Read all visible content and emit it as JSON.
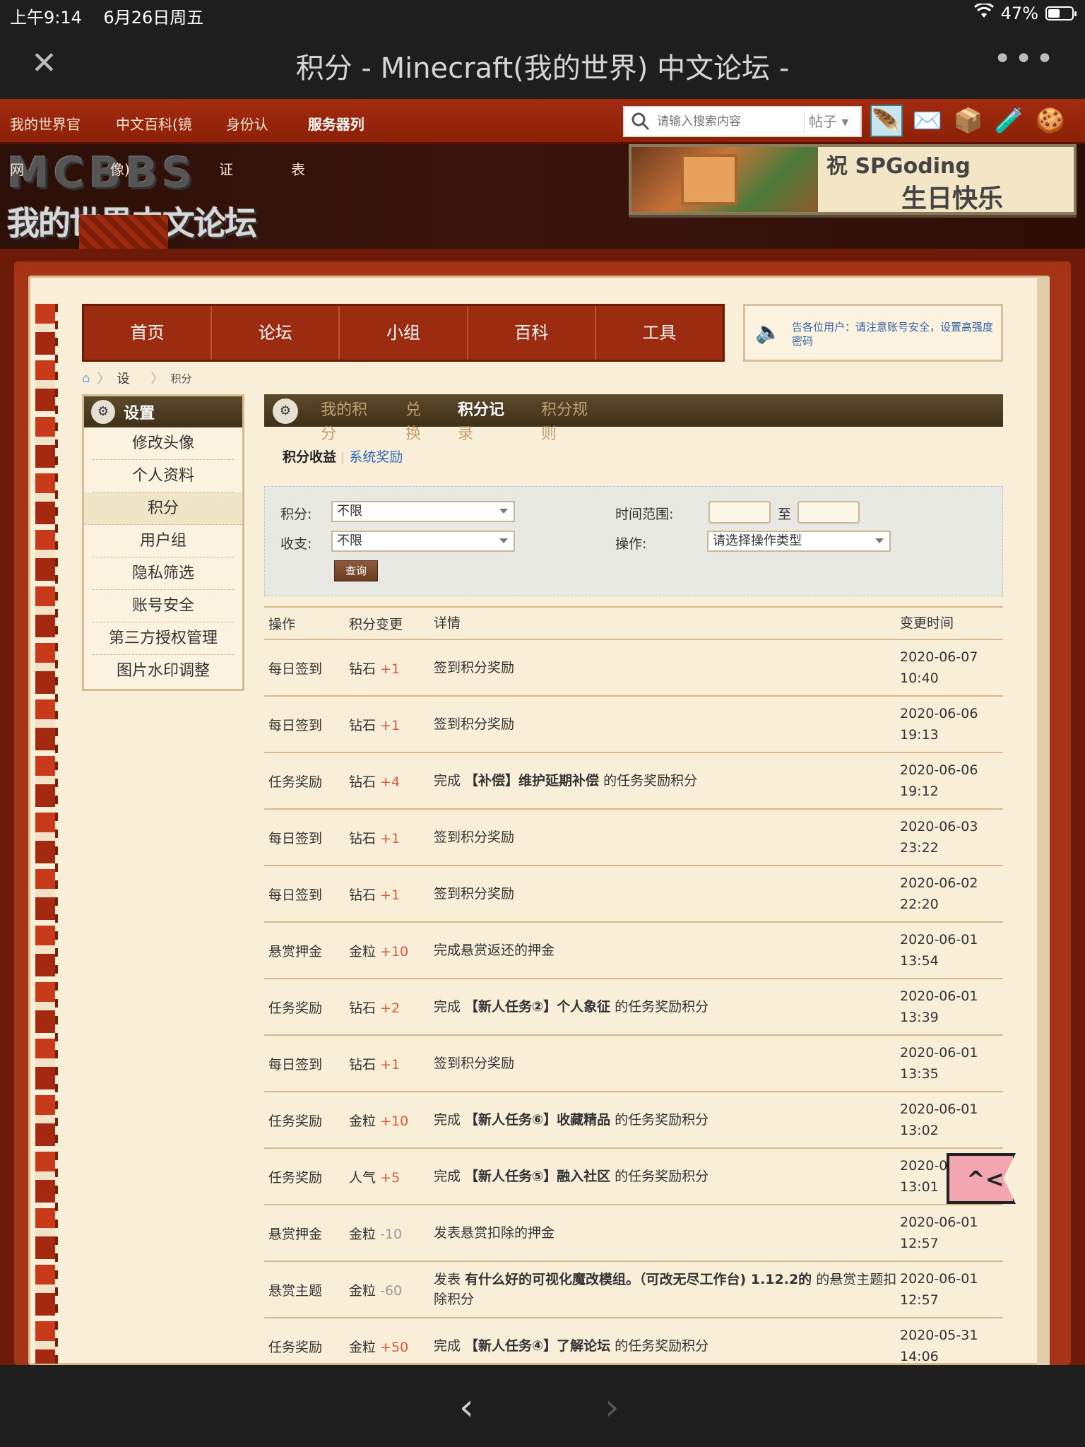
{
  "status": {
    "time": "上午9:14",
    "date": "6月26日周五",
    "battery": "47%"
  },
  "browser": {
    "title": "积分 - Minecraft(我的世界) 中文论坛 -",
    "close": "✕",
    "more": "•••",
    "back": "‹",
    "forward": "›"
  },
  "site_links": [
    {
      "label": "我的世界官",
      "wrap": "网"
    },
    {
      "label": "中文百科(镜",
      "wrap": "像)"
    },
    {
      "label": "身份认",
      "wrap": "证"
    },
    {
      "label": "服务器列",
      "wrap": "表"
    }
  ],
  "search": {
    "placeholder": "请输入搜索内容",
    "scope": "帖子"
  },
  "logo": {
    "top": "MCBBS",
    "bottom": "我的世界中文论坛"
  },
  "birthday": {
    "line1": "祝 SPGoding",
    "line2": "生日快乐"
  },
  "main_nav": [
    "首页",
    "论坛",
    "小组",
    "百科",
    "工具"
  ],
  "notice": "告各位用户：请注意账号安全，设置高强度密码",
  "breadcrumb": {
    "level1": "设",
    "level2": "积分"
  },
  "sidebar": {
    "title": "设置",
    "items": [
      "修改头像",
      "个人资料",
      "积分",
      "用户组",
      "隐私筛选",
      "账号安全",
      "第三方授权管理",
      "图片水印调整"
    ]
  },
  "content_tabs": [
    {
      "line1": "我的积",
      "line2": "分"
    },
    {
      "line1": "兑",
      "line2": "换"
    },
    {
      "line1": "积分记",
      "line2": "录"
    },
    {
      "line1": "积分规",
      "line2": "则"
    }
  ],
  "sub_tabs": {
    "active": "积分收益",
    "other": "系统奖励"
  },
  "filter": {
    "credit_label": "积分:",
    "credit_value": "不限",
    "inout_label": "收支:",
    "inout_value": "不限",
    "time_label": "时间范围:",
    "time_to": "至",
    "op_label": "操作:",
    "op_value": "请选择操作类型",
    "query_button": "查询"
  },
  "table": {
    "headers": [
      "操作",
      "积分变更",
      "详情",
      "变更时间"
    ],
    "rows": [
      {
        "op": "每日签到",
        "credit": "钻石",
        "delta": "+1",
        "sign": "pos",
        "pre": "签到积分奖励",
        "title": "",
        "post": "",
        "date": "2020-06-07",
        "time": "10:40"
      },
      {
        "op": "每日签到",
        "credit": "钻石",
        "delta": "+1",
        "sign": "pos",
        "pre": "签到积分奖励",
        "title": "",
        "post": "",
        "date": "2020-06-06",
        "time": "19:13"
      },
      {
        "op": "任务奖励",
        "credit": "钻石",
        "delta": "+4",
        "sign": "pos",
        "pre": "完成 ",
        "title": "【补偿】维护延期补偿",
        "post": " 的任务奖励积分",
        "date": "2020-06-06",
        "time": "19:12"
      },
      {
        "op": "每日签到",
        "credit": "钻石",
        "delta": "+1",
        "sign": "pos",
        "pre": "签到积分奖励",
        "title": "",
        "post": "",
        "date": "2020-06-03",
        "time": "23:22"
      },
      {
        "op": "每日签到",
        "credit": "钻石",
        "delta": "+1",
        "sign": "pos",
        "pre": "签到积分奖励",
        "title": "",
        "post": "",
        "date": "2020-06-02",
        "time": "22:20"
      },
      {
        "op": "悬赏押金",
        "credit": "金粒",
        "delta": "+10",
        "sign": "pos",
        "pre": "完成悬赏返还的押金",
        "title": "",
        "post": "",
        "date": "2020-06-01",
        "time": "13:54"
      },
      {
        "op": "任务奖励",
        "credit": "钻石",
        "delta": "+2",
        "sign": "pos",
        "pre": "完成 ",
        "title": "【新人任务②】个人象征",
        "post": " 的任务奖励积分",
        "date": "2020-06-01",
        "time": "13:39"
      },
      {
        "op": "每日签到",
        "credit": "钻石",
        "delta": "+1",
        "sign": "pos",
        "pre": "签到积分奖励",
        "title": "",
        "post": "",
        "date": "2020-06-01",
        "time": "13:35"
      },
      {
        "op": "任务奖励",
        "credit": "金粒",
        "delta": "+10",
        "sign": "pos",
        "pre": "完成 ",
        "title": "【新人任务⑥】收藏精品",
        "post": " 的任务奖励积分",
        "date": "2020-06-01",
        "time": "13:02"
      },
      {
        "op": "任务奖励",
        "credit": "人气",
        "delta": "+5",
        "sign": "pos",
        "pre": "完成 ",
        "title": "【新人任务⑤】融入社区",
        "post": " 的任务奖励积分",
        "date": "2020-0",
        "time": "13:01"
      },
      {
        "op": "悬赏押金",
        "credit": "金粒",
        "delta": "-10",
        "sign": "neg",
        "pre": "发表悬赏扣除的押金",
        "title": "",
        "post": "",
        "date": "2020-06-01",
        "time": "12:57"
      },
      {
        "op": "悬赏主题",
        "credit": "金粒",
        "delta": "-60",
        "sign": "neg",
        "pre": "发表 ",
        "title": "有什么好的可视化魔改模组。（可改无尽工作台) 1.12.2的",
        "post": " 的悬赏主题扣除积分",
        "date": "2020-06-01",
        "time": "12:57"
      },
      {
        "op": "任务奖励",
        "credit": "金粒",
        "delta": "+50",
        "sign": "pos",
        "pre": "完成 ",
        "title": "【新人任务④】了解论坛",
        "post": " 的任务奖励积分",
        "date": "2020-05-31",
        "time": "14:06"
      }
    ]
  },
  "sticker": {
    "text": "^<"
  }
}
